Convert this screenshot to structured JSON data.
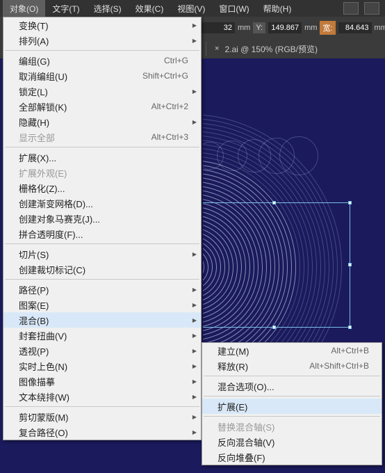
{
  "menubar": {
    "items": [
      "对象(O)",
      "文字(T)",
      "选择(S)",
      "效果(C)",
      "视图(V)",
      "窗口(W)",
      "帮助(H)"
    ],
    "active_index": 0
  },
  "propbar": {
    "x_suffix": "mm",
    "y_lab": "Y:",
    "y_val": "149.867",
    "w_lab": "宽:",
    "w_val": "84.643",
    "unit": "mm"
  },
  "tab": {
    "close": "×",
    "label": "2.ai @ 150% (RGB/预览)"
  },
  "main_menu": [
    {
      "t": "item",
      "label": "变换(T)",
      "sub": true
    },
    {
      "t": "item",
      "label": "排列(A)",
      "sub": true
    },
    {
      "t": "sep"
    },
    {
      "t": "item",
      "label": "编组(G)",
      "sc": "Ctrl+G"
    },
    {
      "t": "item",
      "label": "取消编组(U)",
      "sc": "Shift+Ctrl+G"
    },
    {
      "t": "item",
      "label": "锁定(L)",
      "sub": true
    },
    {
      "t": "item",
      "label": "全部解锁(K)",
      "sc": "Alt+Ctrl+2"
    },
    {
      "t": "item",
      "label": "隐藏(H)",
      "sub": true
    },
    {
      "t": "item",
      "label": "显示全部",
      "sc": "Alt+Ctrl+3",
      "dis": true
    },
    {
      "t": "sep"
    },
    {
      "t": "item",
      "label": "扩展(X)..."
    },
    {
      "t": "item",
      "label": "扩展外观(E)",
      "dis": true
    },
    {
      "t": "item",
      "label": "栅格化(Z)..."
    },
    {
      "t": "item",
      "label": "创建渐变网格(D)..."
    },
    {
      "t": "item",
      "label": "创建对象马赛克(J)..."
    },
    {
      "t": "item",
      "label": "拼合透明度(F)..."
    },
    {
      "t": "sep"
    },
    {
      "t": "item",
      "label": "切片(S)",
      "sub": true
    },
    {
      "t": "item",
      "label": "创建裁切标记(C)"
    },
    {
      "t": "sep"
    },
    {
      "t": "item",
      "label": "路径(P)",
      "sub": true
    },
    {
      "t": "item",
      "label": "图案(E)",
      "sub": true
    },
    {
      "t": "item",
      "label": "混合(B)",
      "sub": true,
      "hl": true
    },
    {
      "t": "item",
      "label": "封套扭曲(V)",
      "sub": true
    },
    {
      "t": "item",
      "label": "透视(P)",
      "sub": true
    },
    {
      "t": "item",
      "label": "实时上色(N)",
      "sub": true
    },
    {
      "t": "item",
      "label": "图像描摹",
      "sub": true
    },
    {
      "t": "item",
      "label": "文本绕排(W)",
      "sub": true
    },
    {
      "t": "sep"
    },
    {
      "t": "item",
      "label": "剪切蒙版(M)",
      "sub": true
    },
    {
      "t": "item",
      "label": "复合路径(O)",
      "sub": true
    }
  ],
  "sub_menu": [
    {
      "t": "item",
      "label": "建立(M)",
      "sc": "Alt+Ctrl+B"
    },
    {
      "t": "item",
      "label": "释放(R)",
      "sc": "Alt+Shift+Ctrl+B"
    },
    {
      "t": "sep"
    },
    {
      "t": "item",
      "label": "混合选项(O)..."
    },
    {
      "t": "sep"
    },
    {
      "t": "item",
      "label": "扩展(E)",
      "hl": true
    },
    {
      "t": "sep"
    },
    {
      "t": "item",
      "label": "替换混合轴(S)",
      "dis": true
    },
    {
      "t": "item",
      "label": "反向混合轴(V)"
    },
    {
      "t": "item",
      "label": "反向堆叠(F)"
    }
  ]
}
